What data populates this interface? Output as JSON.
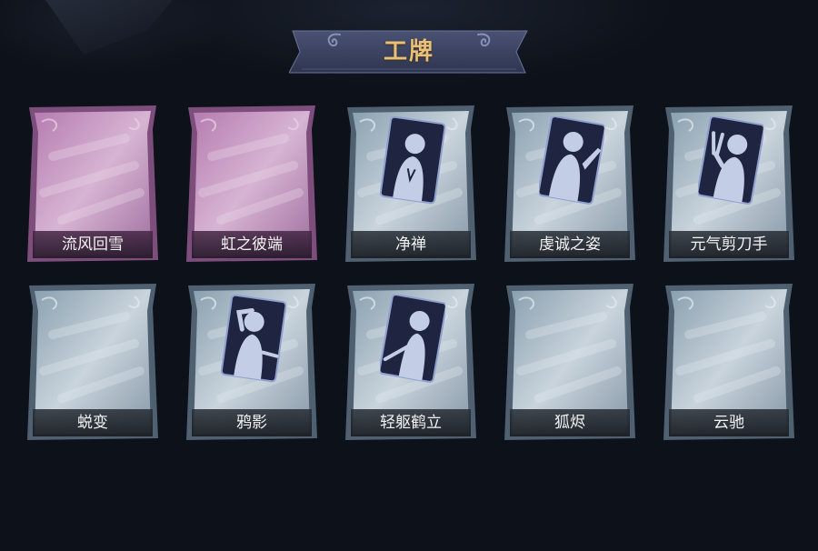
{
  "header": {
    "title": "工牌"
  },
  "colors": {
    "background": "#0d1119",
    "title_gold": "#e8c07a",
    "banner": "#3b4160",
    "card_pink": "#c48fbf",
    "card_blue": "#9fb3c2",
    "portrait_card": "#1f2540",
    "silhouette": "#c3cde6"
  },
  "cards": [
    {
      "label": "流风回雪",
      "variant": "pink",
      "portrait": "none"
    },
    {
      "label": "虹之彼端",
      "variant": "pink",
      "portrait": "none"
    },
    {
      "label": "净禅",
      "variant": "blue",
      "portrait": "silhouette-prayer-icon"
    },
    {
      "label": "虔诚之姿",
      "variant": "blue",
      "portrait": "silhouette-wave-icon"
    },
    {
      "label": "元气剪刀手",
      "variant": "blue",
      "portrait": "silhouette-peace-sign-icon"
    },
    {
      "label": "蜕变",
      "variant": "blue",
      "portrait": "none"
    },
    {
      "label": "鸦影",
      "variant": "blue",
      "portrait": "silhouette-salute-icon"
    },
    {
      "label": "轻躯鹤立",
      "variant": "blue",
      "portrait": "silhouette-stand-icon"
    },
    {
      "label": "狐烬",
      "variant": "blue",
      "portrait": "none"
    },
    {
      "label": "云驰",
      "variant": "blue",
      "portrait": "none"
    }
  ]
}
